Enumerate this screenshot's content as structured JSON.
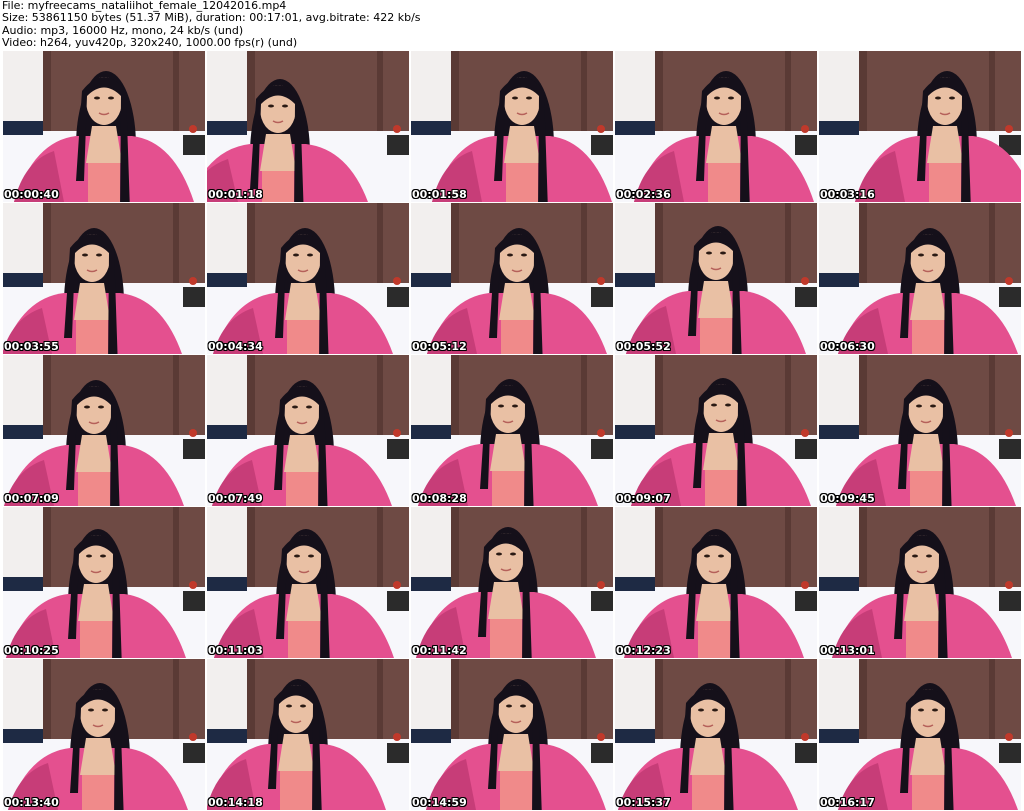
{
  "header": {
    "line1": "File: myfreecams_nataliihot_female_12042016.mp4",
    "line2": "Size: 53861150 bytes (51.37 MiB), duration: 00:17:01, avg.bitrate: 422 kb/s",
    "line3": "Audio: mp3, 16000 Hz, mono, 24 kb/s (und)",
    "line4": "Video: h264, yuv420p, 320x240, 1000.00 fps(r) (und)"
  },
  "colors": {
    "background": "#ffffff",
    "hoodie": "#e4508f",
    "hoodie_shade": "#c73d78",
    "top": "#f08a8a",
    "hair": "#15101a",
    "skin": "#e9c0a4",
    "wall": "#f2efee",
    "curtain": "#6e4a44",
    "bed": "#f7f7fb"
  },
  "thumbnails": [
    {
      "timestamp": "00:00:40"
    },
    {
      "timestamp": "00:01:18"
    },
    {
      "timestamp": "00:01:58"
    },
    {
      "timestamp": "00:02:36"
    },
    {
      "timestamp": "00:03:16"
    },
    {
      "timestamp": "00:03:55"
    },
    {
      "timestamp": "00:04:34"
    },
    {
      "timestamp": "00:05:12"
    },
    {
      "timestamp": "00:05:52"
    },
    {
      "timestamp": "00:06:30"
    },
    {
      "timestamp": "00:07:09"
    },
    {
      "timestamp": "00:07:49"
    },
    {
      "timestamp": "00:08:28"
    },
    {
      "timestamp": "00:09:07"
    },
    {
      "timestamp": "00:09:45"
    },
    {
      "timestamp": "00:10:25"
    },
    {
      "timestamp": "00:11:03"
    },
    {
      "timestamp": "00:11:42"
    },
    {
      "timestamp": "00:12:23"
    },
    {
      "timestamp": "00:13:01"
    },
    {
      "timestamp": "00:13:40"
    },
    {
      "timestamp": "00:14:18"
    },
    {
      "timestamp": "00:14:59"
    },
    {
      "timestamp": "00:15:37"
    },
    {
      "timestamp": "00:16:17"
    }
  ]
}
